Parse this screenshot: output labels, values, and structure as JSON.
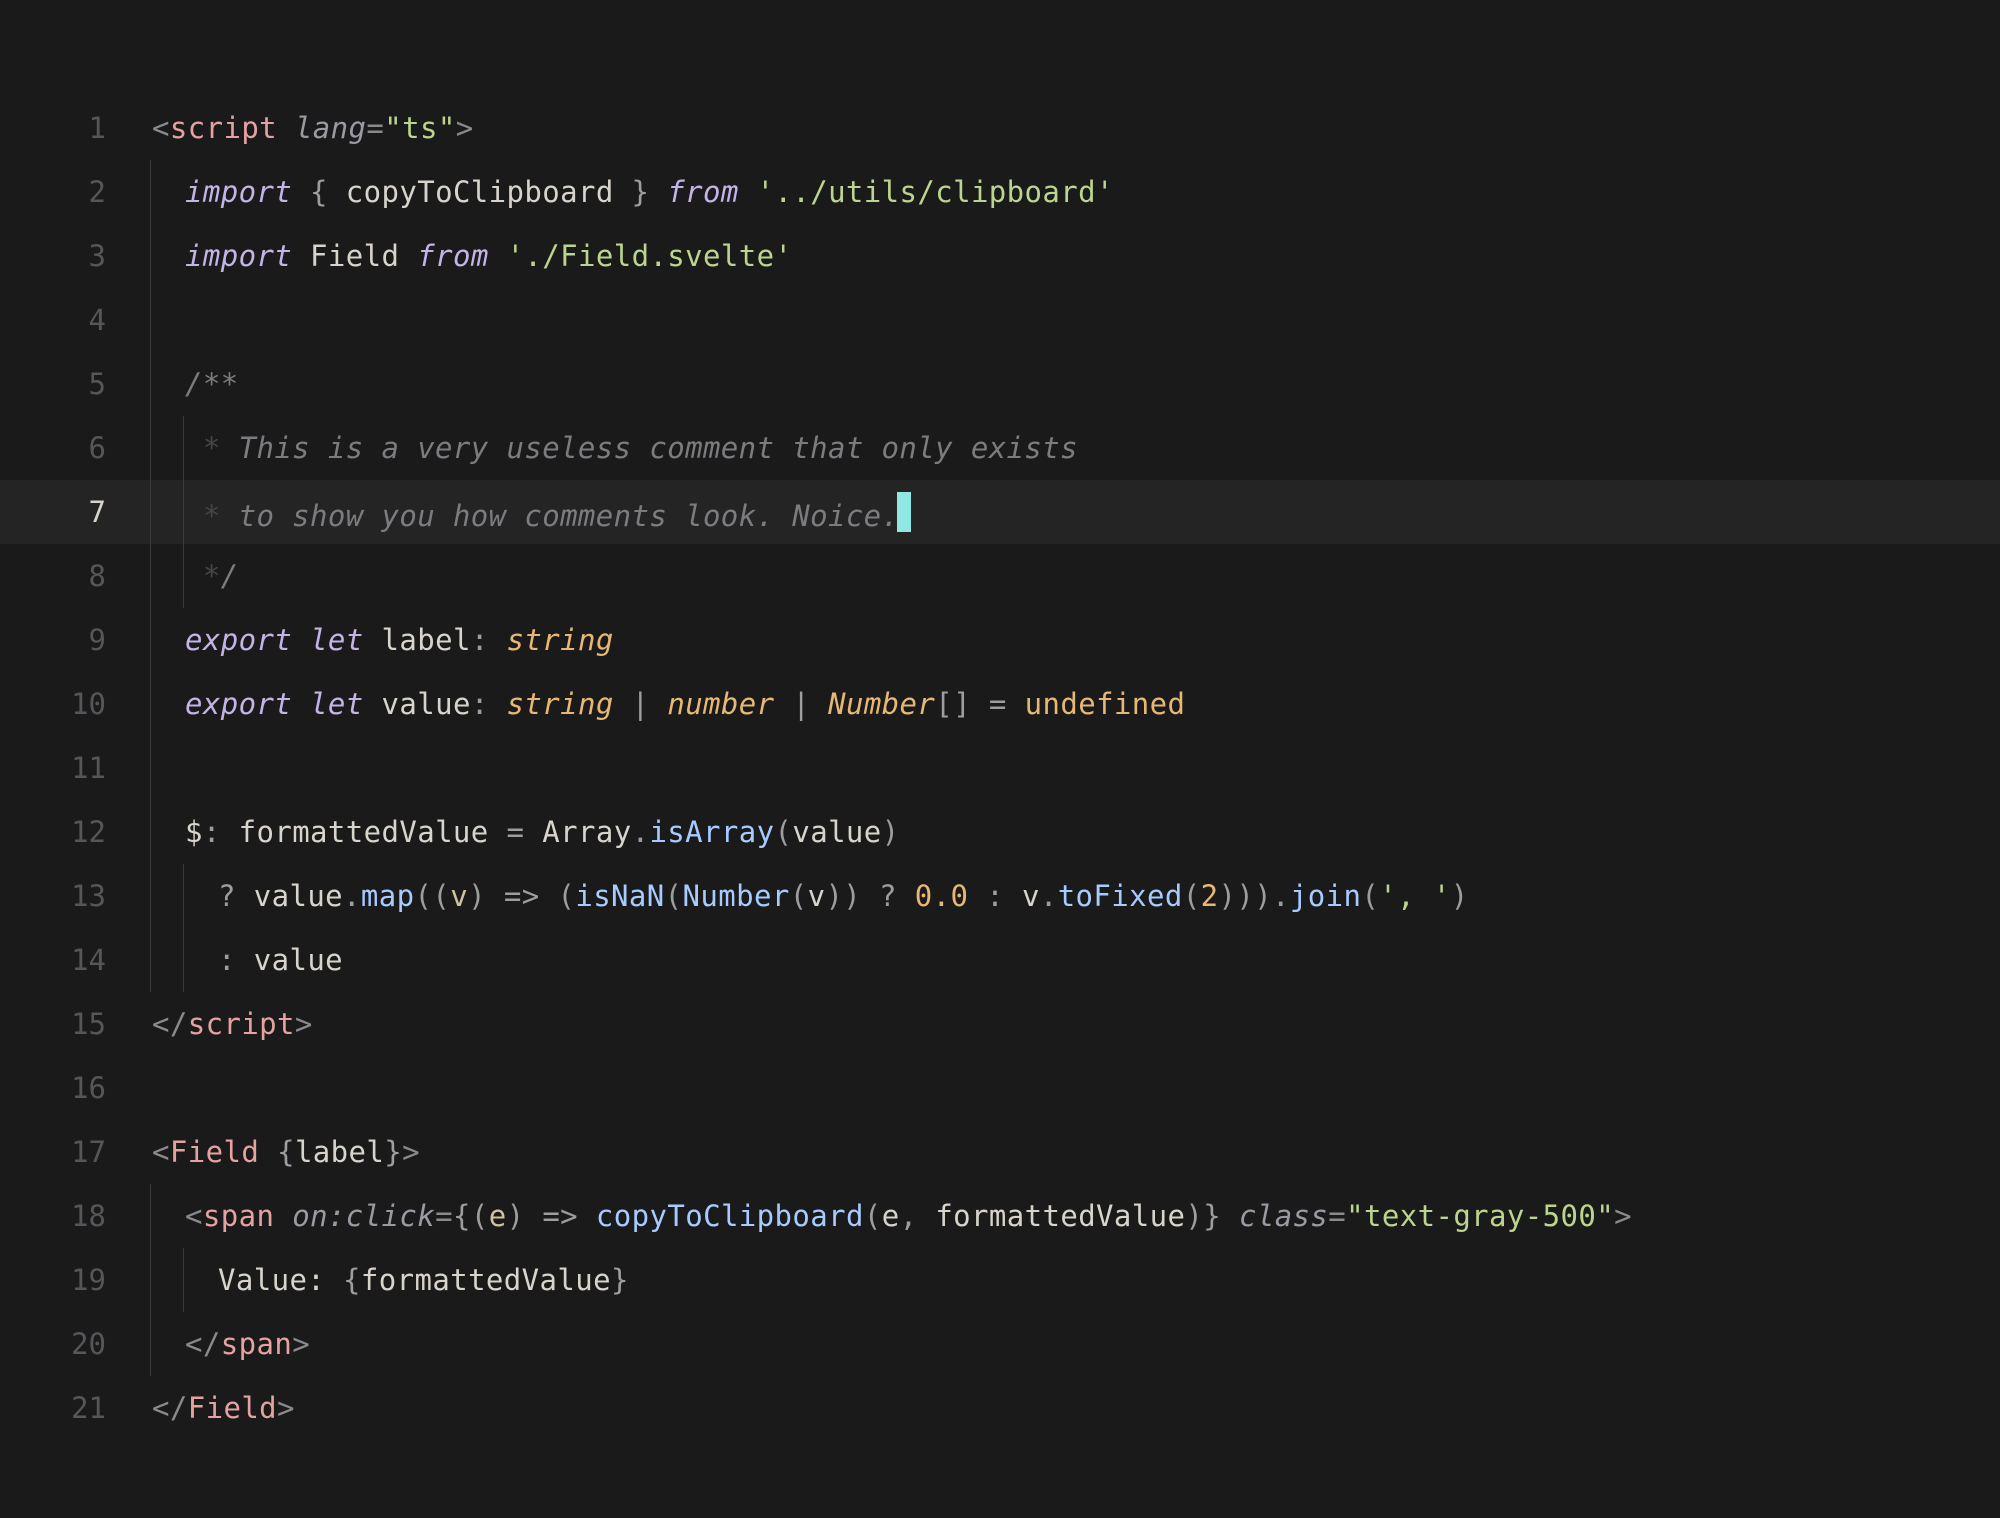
{
  "editor": {
    "highlighted_line": 7,
    "lines": [
      {
        "n": 1,
        "indent": 0,
        "guides": [],
        "tokens": [
          {
            "c": "angle",
            "t": "<"
          },
          {
            "c": "tag",
            "t": "script"
          },
          {
            "c": "ident",
            "t": " "
          },
          {
            "c": "attr",
            "t": "lang"
          },
          {
            "c": "eq",
            "t": "="
          },
          {
            "c": "str",
            "t": "\"ts\""
          },
          {
            "c": "angle",
            "t": ">"
          }
        ]
      },
      {
        "n": 2,
        "indent": 1,
        "guides": [
          0
        ],
        "tokens": [
          {
            "c": "kw",
            "t": "import"
          },
          {
            "c": "ident",
            "t": " "
          },
          {
            "c": "punct",
            "t": "{ "
          },
          {
            "c": "ident",
            "t": "copyToClipboard"
          },
          {
            "c": "punct",
            "t": " }"
          },
          {
            "c": "ident",
            "t": " "
          },
          {
            "c": "kw",
            "t": "from"
          },
          {
            "c": "ident",
            "t": " "
          },
          {
            "c": "str",
            "t": "'../utils/clipboard'"
          }
        ]
      },
      {
        "n": 3,
        "indent": 1,
        "guides": [
          0
        ],
        "tokens": [
          {
            "c": "kw",
            "t": "import"
          },
          {
            "c": "ident",
            "t": " "
          },
          {
            "c": "ident",
            "t": "Field"
          },
          {
            "c": "ident",
            "t": " "
          },
          {
            "c": "kw",
            "t": "from"
          },
          {
            "c": "ident",
            "t": " "
          },
          {
            "c": "str",
            "t": "'./Field.svelte'"
          }
        ]
      },
      {
        "n": 4,
        "indent": 0,
        "guides": [
          0
        ],
        "tokens": []
      },
      {
        "n": 5,
        "indent": 1,
        "guides": [
          0
        ],
        "tokens": [
          {
            "c": "comment",
            "t": "/**"
          }
        ]
      },
      {
        "n": 6,
        "indent": 1,
        "guides": [
          0,
          1
        ],
        "tokens": [
          {
            "c": "commentbar",
            "t": " *"
          },
          {
            "c": "comment",
            "t": " This is a very useless comment that only exists"
          }
        ]
      },
      {
        "n": 7,
        "indent": 1,
        "guides": [
          0,
          1
        ],
        "tokens": [
          {
            "c": "commentbar",
            "t": " *"
          },
          {
            "c": "comment",
            "t": " to show you how comments look. Noice."
          }
        ],
        "cursor_after": true
      },
      {
        "n": 8,
        "indent": 1,
        "guides": [
          0,
          1
        ],
        "tokens": [
          {
            "c": "commentbar",
            "t": " *"
          },
          {
            "c": "comment",
            "t": "/"
          }
        ]
      },
      {
        "n": 9,
        "indent": 1,
        "guides": [
          0
        ],
        "tokens": [
          {
            "c": "kw",
            "t": "export"
          },
          {
            "c": "ident",
            "t": " "
          },
          {
            "c": "kw",
            "t": "let"
          },
          {
            "c": "ident",
            "t": " "
          },
          {
            "c": "ident",
            "t": "label"
          },
          {
            "c": "punct",
            "t": ": "
          },
          {
            "c": "type",
            "t": "string"
          }
        ]
      },
      {
        "n": 10,
        "indent": 1,
        "guides": [
          0
        ],
        "tokens": [
          {
            "c": "kw",
            "t": "export"
          },
          {
            "c": "ident",
            "t": " "
          },
          {
            "c": "kw",
            "t": "let"
          },
          {
            "c": "ident",
            "t": " "
          },
          {
            "c": "ident",
            "t": "value"
          },
          {
            "c": "punct",
            "t": ": "
          },
          {
            "c": "type",
            "t": "string"
          },
          {
            "c": "punct",
            "t": " | "
          },
          {
            "c": "type",
            "t": "number"
          },
          {
            "c": "punct",
            "t": " | "
          },
          {
            "c": "type",
            "t": "Number"
          },
          {
            "c": "punct",
            "t": "[]"
          },
          {
            "c": "ident",
            "t": " "
          },
          {
            "c": "op",
            "t": "="
          },
          {
            "c": "ident",
            "t": " "
          },
          {
            "c": "undef",
            "t": "undefined"
          }
        ]
      },
      {
        "n": 11,
        "indent": 0,
        "guides": [
          0
        ],
        "tokens": []
      },
      {
        "n": 12,
        "indent": 1,
        "guides": [
          0
        ],
        "tokens": [
          {
            "c": "ident",
            "t": "$"
          },
          {
            "c": "punct",
            "t": ": "
          },
          {
            "c": "ident",
            "t": "formattedValue "
          },
          {
            "c": "op",
            "t": "="
          },
          {
            "c": "ident",
            "t": " Array"
          },
          {
            "c": "punct",
            "t": "."
          },
          {
            "c": "fn",
            "t": "isArray"
          },
          {
            "c": "punct",
            "t": "("
          },
          {
            "c": "ident",
            "t": "value"
          },
          {
            "c": "punct",
            "t": ")"
          }
        ]
      },
      {
        "n": 13,
        "indent": 2,
        "guides": [
          0,
          1
        ],
        "tokens": [
          {
            "c": "punct",
            "t": "? "
          },
          {
            "c": "ident",
            "t": "value"
          },
          {
            "c": "punct",
            "t": "."
          },
          {
            "c": "fn",
            "t": "map"
          },
          {
            "c": "punct",
            "t": "(("
          },
          {
            "c": "param",
            "t": "v"
          },
          {
            "c": "punct",
            "t": ") "
          },
          {
            "c": "op",
            "t": "=>"
          },
          {
            "c": "punct",
            "t": " ("
          },
          {
            "c": "fn",
            "t": "isNaN"
          },
          {
            "c": "punct",
            "t": "("
          },
          {
            "c": "fn",
            "t": "Number"
          },
          {
            "c": "punct",
            "t": "("
          },
          {
            "c": "ident",
            "t": "v"
          },
          {
            "c": "punct",
            "t": ")) ? "
          },
          {
            "c": "num",
            "t": "0.0"
          },
          {
            "c": "punct",
            "t": " : "
          },
          {
            "c": "ident",
            "t": "v"
          },
          {
            "c": "punct",
            "t": "."
          },
          {
            "c": "fn",
            "t": "toFixed"
          },
          {
            "c": "punct",
            "t": "("
          },
          {
            "c": "num",
            "t": "2"
          },
          {
            "c": "punct",
            "t": ")))."
          },
          {
            "c": "fn",
            "t": "join"
          },
          {
            "c": "punct",
            "t": "("
          },
          {
            "c": "str",
            "t": "', '"
          },
          {
            "c": "punct",
            "t": ")"
          }
        ]
      },
      {
        "n": 14,
        "indent": 2,
        "guides": [
          0,
          1
        ],
        "tokens": [
          {
            "c": "punct",
            "t": ": "
          },
          {
            "c": "ident",
            "t": "value"
          }
        ]
      },
      {
        "n": 15,
        "indent": 0,
        "guides": [],
        "tokens": [
          {
            "c": "angle",
            "t": "</"
          },
          {
            "c": "tag",
            "t": "script"
          },
          {
            "c": "angle",
            "t": ">"
          }
        ]
      },
      {
        "n": 16,
        "indent": 0,
        "guides": [],
        "tokens": []
      },
      {
        "n": 17,
        "indent": 0,
        "guides": [],
        "tokens": [
          {
            "c": "angle",
            "t": "<"
          },
          {
            "c": "tag",
            "t": "Field"
          },
          {
            "c": "ident",
            "t": " "
          },
          {
            "c": "punct",
            "t": "{"
          },
          {
            "c": "actual",
            "t": "label"
          },
          {
            "c": "punct",
            "t": "}"
          },
          {
            "c": "angle",
            "t": ">"
          }
        ]
      },
      {
        "n": 18,
        "indent": 1,
        "guides": [
          0
        ],
        "tokens": [
          {
            "c": "angle",
            "t": "<"
          },
          {
            "c": "tag",
            "t": "span"
          },
          {
            "c": "ident",
            "t": " "
          },
          {
            "c": "attr",
            "t": "on:click"
          },
          {
            "c": "eq",
            "t": "="
          },
          {
            "c": "punct",
            "t": "{("
          },
          {
            "c": "param",
            "t": "e"
          },
          {
            "c": "punct",
            "t": ") "
          },
          {
            "c": "op",
            "t": "=>"
          },
          {
            "c": "ident",
            "t": " "
          },
          {
            "c": "fn",
            "t": "copyToClipboard"
          },
          {
            "c": "punct",
            "t": "("
          },
          {
            "c": "ident",
            "t": "e"
          },
          {
            "c": "punct",
            "t": ", "
          },
          {
            "c": "ident",
            "t": "formattedValue"
          },
          {
            "c": "punct",
            "t": ")}"
          },
          {
            "c": "ident",
            "t": " "
          },
          {
            "c": "attr",
            "t": "class"
          },
          {
            "c": "eq",
            "t": "="
          },
          {
            "c": "str",
            "t": "\"text-gray-500\""
          },
          {
            "c": "angle",
            "t": ">"
          }
        ]
      },
      {
        "n": 19,
        "indent": 2,
        "guides": [
          0,
          1
        ],
        "tokens": [
          {
            "c": "ident",
            "t": "Value: "
          },
          {
            "c": "punct",
            "t": "{"
          },
          {
            "c": "ident",
            "t": "formattedValue"
          },
          {
            "c": "punct",
            "t": "}"
          }
        ]
      },
      {
        "n": 20,
        "indent": 1,
        "guides": [
          0
        ],
        "tokens": [
          {
            "c": "angle",
            "t": "</"
          },
          {
            "c": "tag",
            "t": "span"
          },
          {
            "c": "angle",
            "t": ">"
          }
        ]
      },
      {
        "n": 21,
        "indent": 0,
        "guides": [],
        "tokens": [
          {
            "c": "angle",
            "t": "</"
          },
          {
            "c": "tag",
            "t": "Field"
          },
          {
            "c": "angle",
            "t": ">"
          }
        ]
      }
    ]
  }
}
